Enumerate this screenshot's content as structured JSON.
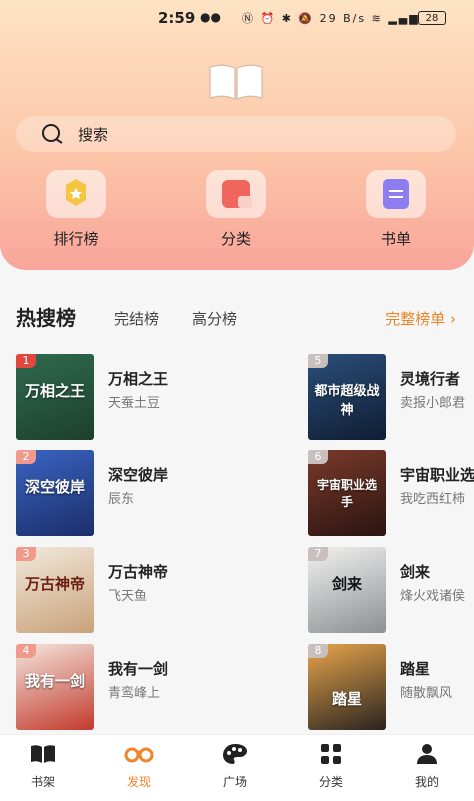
{
  "status": {
    "time": "2:59",
    "net_speed": "29 B/s",
    "battery": "28"
  },
  "search": {
    "placeholder": "搜索"
  },
  "quick_actions": [
    {
      "label": "排行榜",
      "icon": "ranking-icon"
    },
    {
      "label": "分类",
      "icon": "category-icon"
    },
    {
      "label": "书单",
      "icon": "booklist-icon"
    }
  ],
  "tabs": {
    "hot": "热搜榜",
    "finished": "完结榜",
    "high_score": "高分榜",
    "full_list": "完整榜单"
  },
  "books_left": [
    {
      "rank": "1",
      "title": "万相之王",
      "author": "天蚕土豆",
      "cover_text": "万相之王"
    },
    {
      "rank": "2",
      "title": "深空彼岸",
      "author": "辰东",
      "cover_text": "深空彼岸"
    },
    {
      "rank": "3",
      "title": "万古神帝",
      "author": "飞天鱼",
      "cover_text": "万古神帝"
    },
    {
      "rank": "4",
      "title": "我有一剑",
      "author": "青鸾峰上",
      "cover_text": "我有一剑"
    }
  ],
  "books_right": [
    {
      "rank": "5",
      "title": "灵境行者",
      "author": "卖报小郎君",
      "cover_text": "都市超级战神"
    },
    {
      "rank": "6",
      "title": "宇宙职业选手",
      "author": "我吃西红柿",
      "cover_text": "宇宙职业选手"
    },
    {
      "rank": "7",
      "title": "剑来",
      "author": "烽火戏诸侯",
      "cover_text": "剑来"
    },
    {
      "rank": "8",
      "title": "踏星",
      "author": "随散飘风",
      "cover_text": "踏星"
    }
  ],
  "bottom_nav": [
    {
      "label": "书架",
      "icon": "bookshelf-icon",
      "active": false
    },
    {
      "label": "发现",
      "icon": "discover-icon",
      "active": true
    },
    {
      "label": "广场",
      "icon": "palette-icon",
      "active": false
    },
    {
      "label": "分类",
      "icon": "grid-icon",
      "active": false
    },
    {
      "label": "我的",
      "icon": "person-icon",
      "active": false
    }
  ],
  "colors": {
    "accent": "#f0852d",
    "rank_badge": "#e2473f",
    "rank_badge_other": "#f09a8e"
  }
}
